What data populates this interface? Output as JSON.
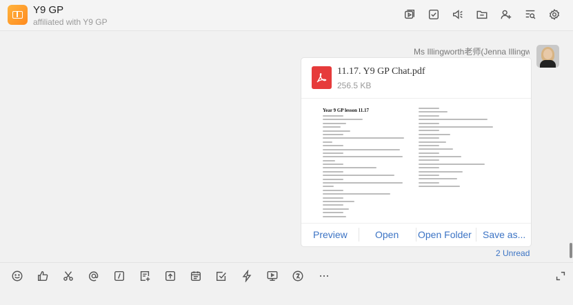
{
  "header": {
    "title": "Y9 GP",
    "subtitle": "affiliated with Y9 GP",
    "icons": [
      "video-icon",
      "checklist-icon",
      "announcement-icon",
      "folder-icon",
      "add-member-icon",
      "search-history-icon",
      "settings-icon"
    ]
  },
  "message": {
    "sender": "Ms Illingworth老师(Jenna Illingworth)",
    "file": {
      "name": "11.17. Y9 GP Chat.pdf",
      "size": "256.5 KB",
      "preview_title": "Year 9 GP lesson 11.17"
    },
    "actions": {
      "preview": "Preview",
      "open": "Open",
      "open_folder": "Open Folder",
      "save_as": "Save as..."
    },
    "unread": "2 Unread"
  },
  "toolbar": {
    "icons": [
      "emoji-icon",
      "like-icon",
      "scissors-icon",
      "mention-icon",
      "slash-command-icon",
      "doc-add-icon",
      "upload-icon",
      "calendar-icon",
      "task-icon",
      "quick-reply-icon",
      "screen-share-icon",
      "translate-icon",
      "more-icon",
      "expand-icon"
    ]
  },
  "colors": {
    "accent": "#3b73c4",
    "pdf": "#e63b3b",
    "group_avatar": "#ff9b2a"
  }
}
